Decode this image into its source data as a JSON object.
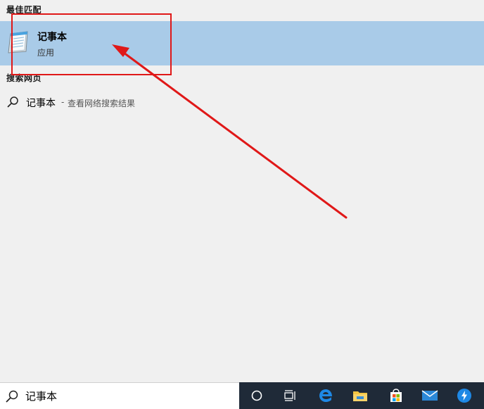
{
  "best_match": {
    "header": "最佳匹配",
    "app_name": "记事本",
    "app_type": "应用"
  },
  "web": {
    "header": "搜索网页",
    "query": "记事本",
    "separator": "-",
    "hint": "查看网络搜索结果"
  },
  "search": {
    "value": "记事本"
  },
  "colors": {
    "selection": "#a9cbe8",
    "annotation": "#e01818",
    "taskbar": "#1f2a38"
  },
  "taskbar_icons": [
    "cortana-icon",
    "task-view-icon",
    "edge-icon",
    "file-explorer-icon",
    "store-icon",
    "mail-icon",
    "app-icon"
  ]
}
